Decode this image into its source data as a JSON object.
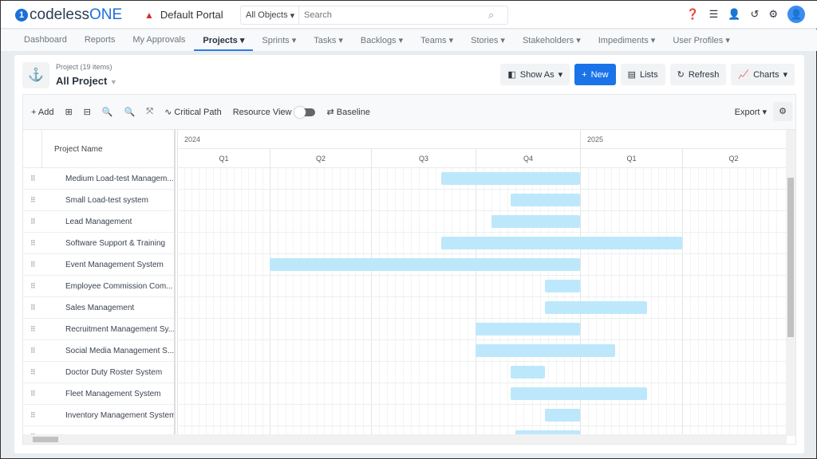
{
  "header": {
    "brand_prefix": "codeless",
    "brand_suffix": "ONE",
    "portal": "Default Portal",
    "object_select": "All Objects",
    "search_placeholder": "Search"
  },
  "nav": [
    {
      "label": "Dashboard",
      "dd": false
    },
    {
      "label": "Reports",
      "dd": false
    },
    {
      "label": "My Approvals",
      "dd": false
    },
    {
      "label": "Projects",
      "dd": true,
      "active": true
    },
    {
      "label": "Sprints",
      "dd": true
    },
    {
      "label": "Tasks",
      "dd": true
    },
    {
      "label": "Backlogs",
      "dd": true
    },
    {
      "label": "Teams",
      "dd": true
    },
    {
      "label": "Stories",
      "dd": true
    },
    {
      "label": "Stakeholders",
      "dd": true
    },
    {
      "label": "Impediments",
      "dd": true
    },
    {
      "label": "User Profiles",
      "dd": true
    }
  ],
  "page": {
    "subtitle": "Project (19 items)",
    "title": "All Project"
  },
  "actions": {
    "show_as": "Show As",
    "new": "New",
    "lists": "Lists",
    "refresh": "Refresh",
    "charts": "Charts"
  },
  "toolbar": {
    "add": "Add",
    "critical_path": "Critical Path",
    "resource_view": "Resource View",
    "resource_view_on": false,
    "baseline": "Baseline",
    "export": "Export"
  },
  "grid": {
    "column": "Project Name"
  },
  "timeline": {
    "years": [
      {
        "label": "2024",
        "quarters": [
          "Q1",
          "Q2",
          "Q3",
          "Q4"
        ]
      },
      {
        "label": "2025",
        "quarters": [
          "Q1",
          "Q2"
        ]
      }
    ]
  },
  "bar_color": "#bde8fb",
  "accent": "#1a73e8",
  "rows": [
    {
      "name": "Medium Load-test Managem...",
      "start": "2024-09-01",
      "end": "2025-01-01"
    },
    {
      "name": "Small Load-test system",
      "start": "2024-11-01",
      "end": "2025-01-01"
    },
    {
      "name": "Lead Management",
      "start": "2024-10-15",
      "end": "2025-01-01"
    },
    {
      "name": "Software Support & Training",
      "start": "2024-09-01",
      "end": "2025-04-01"
    },
    {
      "name": "Event Management System",
      "start": "2024-04-01",
      "end": "2025-01-01"
    },
    {
      "name": "Employee Commission Com...",
      "start": "2024-12-01",
      "end": "2025-01-01"
    },
    {
      "name": "Sales Management",
      "start": "2024-12-01",
      "end": "2025-03-01"
    },
    {
      "name": "Recruitment Management Sy...",
      "start": "2024-10-01",
      "end": "2025-01-01"
    },
    {
      "name": "Social Media Management S...",
      "start": "2024-10-01",
      "end": "2025-02-01"
    },
    {
      "name": "Doctor Duty Roster System",
      "start": "2024-11-01",
      "end": "2024-12-01"
    },
    {
      "name": "Fleet Management System",
      "start": "2024-11-01",
      "end": "2025-03-01"
    },
    {
      "name": "Inventory Management System",
      "start": "2024-12-01",
      "end": "2025-01-01"
    },
    {
      "name": "",
      "start": "2024-11-05",
      "end": "2025-01-01"
    }
  ]
}
